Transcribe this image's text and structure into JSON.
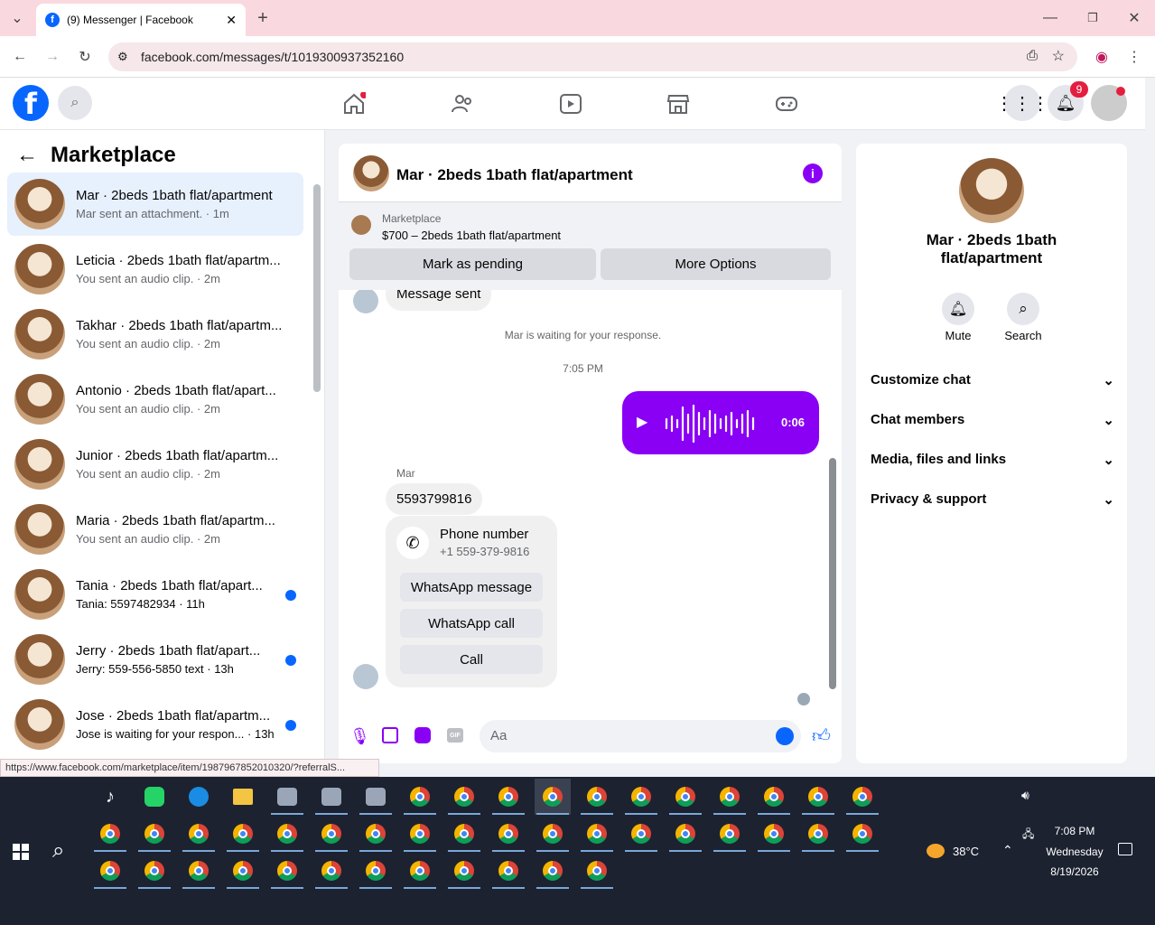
{
  "browser": {
    "tab_title": "(9) Messenger | Facebook",
    "url": "facebook.com/messages/t/1019300937352160",
    "status_url": "https://www.facebook.com/marketplace/item/1987967852010320/?referralS..."
  },
  "header": {
    "notif_count": "9"
  },
  "left": {
    "title": "Marketplace",
    "conversations": [
      {
        "name": "Mar · 2beds 1bath flat/apartment",
        "snippet": "Mar sent an attachment. · 1m",
        "unread": false,
        "active": true
      },
      {
        "name": "Leticia · 2beds 1bath flat/apartm...",
        "snippet": "You sent an audio clip. · 2m",
        "unread": false
      },
      {
        "name": "Takhar · 2beds 1bath flat/apartm...",
        "snippet": "You sent an audio clip. · 2m",
        "unread": false
      },
      {
        "name": "Antonio · 2beds 1bath flat/apart...",
        "snippet": "You sent an audio clip. · 2m",
        "unread": false
      },
      {
        "name": "Junior · 2beds 1bath flat/apartm...",
        "snippet": "You sent an audio clip. · 2m",
        "unread": false
      },
      {
        "name": "Maria · 2beds 1bath flat/apartm...",
        "snippet": "You sent an audio clip. · 2m",
        "unread": false
      },
      {
        "name": "Tania · 2beds 1bath flat/apart...",
        "snippet": "Tania: 5597482934 · 11h",
        "unread": true
      },
      {
        "name": "Jerry · 2beds 1bath flat/apart...",
        "snippet": "Jerry: 559-556-5850 text · 13h",
        "unread": true
      },
      {
        "name": "Jose · 2beds 1bath flat/apartm...",
        "snippet": "Jose is waiting for your respon... · 13h",
        "unread": true
      }
    ]
  },
  "chat": {
    "title": "Mar · 2beds 1bath flat/apartment",
    "listing_label": "Marketplace",
    "listing_price": "$700 – 2beds 1bath flat/apartment",
    "mark_pending": "Mark as pending",
    "more_options": "More Options",
    "prev_msg": "Message sent",
    "waiting": "Mar is waiting for your response.",
    "time": "7:05 PM",
    "audio_duration": "0:06",
    "sender": "Mar",
    "phone_msg": "5593799816",
    "card_title": "Phone number",
    "card_number": "+1 559-379-9816",
    "whatsapp_msg": "WhatsApp message",
    "whatsapp_call": "WhatsApp call",
    "call": "Call",
    "input_placeholder": "Aa"
  },
  "right": {
    "name": "Mar · 2beds 1bath flat/apartment",
    "mute": "Mute",
    "search": "Search",
    "sections": [
      "Customize chat",
      "Chat members",
      "Media, files and links",
      "Privacy & support"
    ]
  },
  "taskbar": {
    "temp": "38°C",
    "time": "7:08 PM",
    "day": "Wednesday",
    "date": "8/19/2026"
  },
  "colors": {
    "accent": "#8a00f5",
    "fb_blue": "#0866ff"
  }
}
